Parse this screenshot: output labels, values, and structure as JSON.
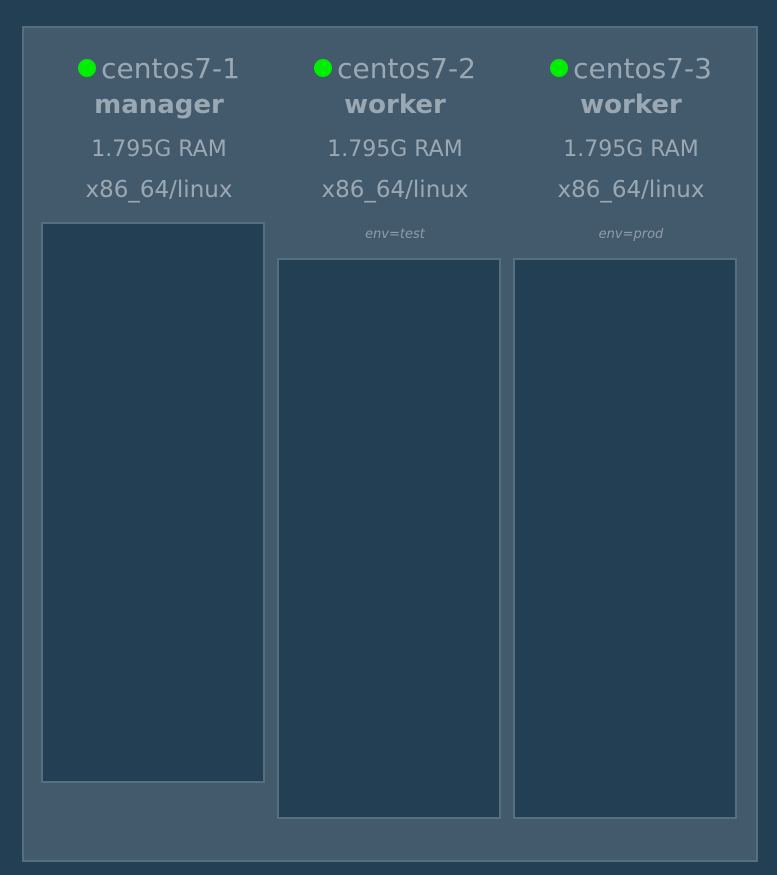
{
  "colors": {
    "background": "#223f53",
    "panel": "#435a6d",
    "border": "#54707f",
    "text": "#9aa8b3",
    "status_ready": "#00ee00"
  },
  "nodes": [
    {
      "hostname": "centos7-1",
      "role": "manager",
      "ram": "1.795G RAM",
      "arch": "x86_64/linux",
      "label": "",
      "status": "ready",
      "status_icon": "status-dot-icon"
    },
    {
      "hostname": "centos7-2",
      "role": "worker",
      "ram": "1.795G RAM",
      "arch": "x86_64/linux",
      "label": "env=test",
      "status": "ready",
      "status_icon": "status-dot-icon"
    },
    {
      "hostname": "centos7-3",
      "role": "worker",
      "ram": "1.795G RAM",
      "arch": "x86_64/linux",
      "label": "env=prod",
      "status": "ready",
      "status_icon": "status-dot-icon"
    }
  ]
}
